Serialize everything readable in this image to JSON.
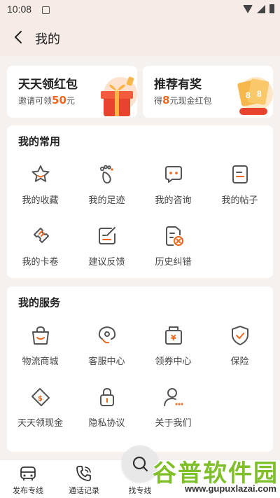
{
  "status_bar": {
    "time": "10:08"
  },
  "header": {
    "title": "我的"
  },
  "promos": [
    {
      "title": "天天领红包",
      "prefix": "邀请可领",
      "highlight": "50",
      "suffix": "元"
    },
    {
      "title": "推荐有奖",
      "prefix": "得",
      "highlight": "8",
      "suffix": "元现金红包"
    }
  ],
  "common": {
    "title": "我的常用",
    "items": [
      {
        "label": "我的收藏",
        "icon": "star-icon"
      },
      {
        "label": "我的足迹",
        "icon": "footprint-icon"
      },
      {
        "label": "我的咨询",
        "icon": "chat-icon"
      },
      {
        "label": "我的帖子",
        "icon": "post-icon"
      },
      {
        "label": "我的卡卷",
        "icon": "ticket-icon"
      },
      {
        "label": "建议反馈",
        "icon": "feedback-icon"
      },
      {
        "label": "历史纠错",
        "icon": "correction-icon"
      }
    ]
  },
  "services": {
    "title": "我的服务",
    "items": [
      {
        "label": "物流商城",
        "icon": "bag-icon"
      },
      {
        "label": "客服中心",
        "icon": "headset-icon"
      },
      {
        "label": "领券中心",
        "icon": "coupon-icon"
      },
      {
        "label": "保险",
        "icon": "shield-icon"
      },
      {
        "label": "天天领现金",
        "icon": "cash-icon"
      },
      {
        "label": "隐私协议",
        "icon": "lock-icon"
      },
      {
        "label": "关于我们",
        "icon": "about-icon"
      }
    ]
  },
  "bottom_nav": {
    "items": [
      {
        "label": "发布专线",
        "icon": "truck-icon"
      },
      {
        "label": "通话记录",
        "icon": "phone-icon"
      },
      {
        "label": "找专线",
        "icon": "search-icon"
      }
    ]
  },
  "watermark": {
    "brand": "谷普软件园",
    "url": "www.gupuxlazai.com"
  },
  "colors": {
    "accent": "#f0651e",
    "icon": "#555555",
    "header_bg": "#f6ebe6"
  }
}
